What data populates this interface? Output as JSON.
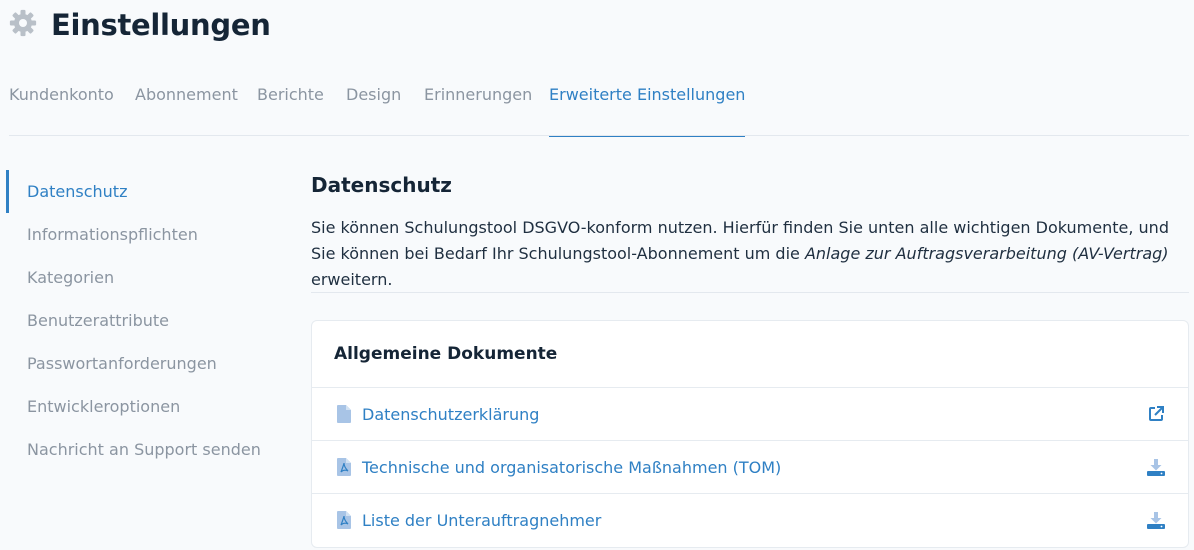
{
  "header": {
    "title": "Einstellungen",
    "icon": "gear-icon"
  },
  "tabs": [
    {
      "label": "Kundenkonto",
      "active": false
    },
    {
      "label": "Abonnement",
      "active": false
    },
    {
      "label": "Berichte",
      "active": false
    },
    {
      "label": "Design",
      "active": false
    },
    {
      "label": "Erinnerungen",
      "active": false
    },
    {
      "label": "Erweiterte Einstellungen",
      "active": true
    }
  ],
  "sidebar": {
    "items": [
      {
        "label": "Datenschutz",
        "active": true
      },
      {
        "label": "Informationspflichten",
        "active": false
      },
      {
        "label": "Kategorien",
        "active": false
      },
      {
        "label": "Benutzerattribute",
        "active": false
      },
      {
        "label": "Passwortanforderungen",
        "active": false
      },
      {
        "label": "Entwickleroptionen",
        "active": false
      },
      {
        "label": "Nachricht an Support senden",
        "active": false
      }
    ]
  },
  "main": {
    "title": "Datenschutz",
    "intro_before": "Sie können Schulungstool DSGVO-konform nutzen. Hierfür finden Sie unten alle wichtigen Dokumente, und Sie können bei Bedarf Ihr Schulungstool-Abonnement um die ",
    "intro_italic": "Anlage zur Auftragsverarbeitung (AV-Vertrag)",
    "intro_after": " erweitern.",
    "card": {
      "title": "Allgemeine Dokumente",
      "rows": [
        {
          "label": "Datenschutzerklärung",
          "icon": "document-icon",
          "action": "external-link-icon"
        },
        {
          "label": "Technische und organisatorische Maßnahmen (TOM)",
          "icon": "pdf-file-icon",
          "action": "download-icon"
        },
        {
          "label": "Liste der Unterauftragnehmer",
          "icon": "pdf-file-icon",
          "action": "download-icon"
        }
      ]
    }
  },
  "colors": {
    "accent": "#2f80c4",
    "muted": "#8b95a1",
    "icon_light": "#a8c4e6"
  }
}
